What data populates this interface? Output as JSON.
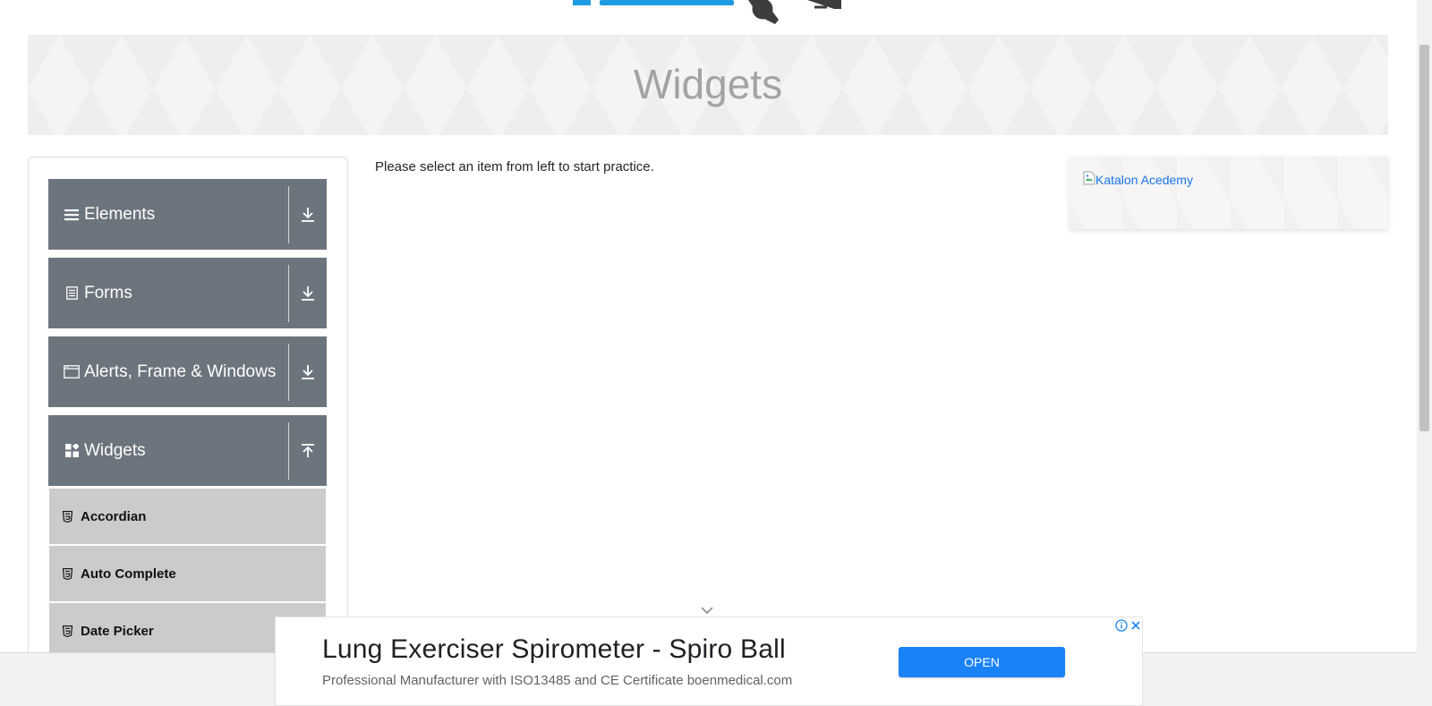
{
  "banner": {
    "title": "Widgets"
  },
  "sidebar": {
    "groups": [
      {
        "label": "Elements",
        "icon": "hamburger-icon",
        "arrow": "download-arrow-icon"
      },
      {
        "label": "Forms",
        "icon": "document-icon",
        "arrow": "download-arrow-icon"
      },
      {
        "label": "Alerts, Frame & Windows",
        "icon": "window-icon",
        "arrow": "download-arrow-icon"
      },
      {
        "label": "Widgets",
        "icon": "widgets-grid-icon",
        "arrow": "upload-arrow-icon"
      }
    ],
    "widget_items": [
      {
        "label": "Accordian",
        "icon": "html5-icon"
      },
      {
        "label": "Auto Complete",
        "icon": "html5-icon"
      },
      {
        "label": "Date Picker",
        "icon": "html5-icon"
      }
    ]
  },
  "main": {
    "instruction": "Please select an item from left to start practice."
  },
  "side_ad": {
    "alt_text": "Katalon Acedemy"
  },
  "bottom_ad": {
    "title": "Lung Exerciser Spirometer - Spiro Ball",
    "description": "Professional Manufacturer with ISO13485 and CE Certificate boenmedical.com",
    "button_label": "OPEN"
  },
  "colors": {
    "sidebar_header": "#6c757d",
    "sidebar_item": "#cbcbcb",
    "ad_button": "#1a82f7",
    "banner_title": "#a3a3a3",
    "logo_blue": "#1e9be0"
  }
}
